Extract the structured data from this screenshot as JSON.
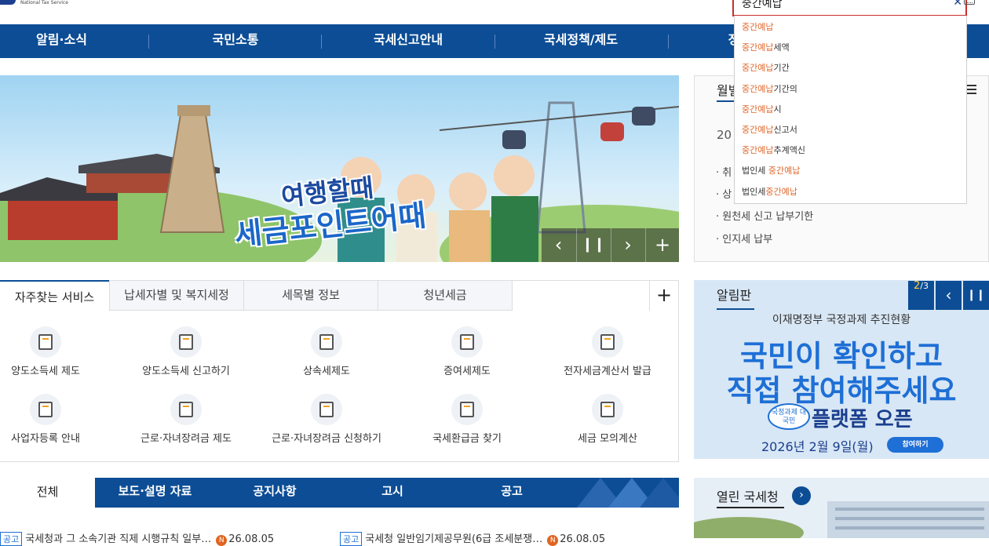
{
  "header": {
    "logo_subtitle": "National Tax Service",
    "search": {
      "value": "중간예납",
      "placeholder": ""
    }
  },
  "gnb": {
    "items": [
      "알림·소식",
      "국민소통",
      "국세신고안내",
      "국세정책/제도",
      "정"
    ]
  },
  "autocomplete": {
    "suggestions": [
      {
        "pre": "",
        "hl": "중간예납",
        "post": ""
      },
      {
        "pre": "",
        "hl": "중간예납",
        "post": "세액"
      },
      {
        "pre": "",
        "hl": "중간예납",
        "post": "기간"
      },
      {
        "pre": "",
        "hl": "중간예납",
        "post": "기간의"
      },
      {
        "pre": "",
        "hl": "중간예납",
        "post": "시"
      },
      {
        "pre": "",
        "hl": "중간예납",
        "post": "신고서"
      },
      {
        "pre": "",
        "hl": "중간예납",
        "post": "추계액신"
      },
      {
        "pre": "법인세 ",
        "hl": "중간예납",
        "post": ""
      },
      {
        "pre": "법인세",
        "hl": "중간예납",
        "post": ""
      }
    ]
  },
  "banner": {
    "title_line1": "여행할때",
    "title_line2": "세금포인트어때"
  },
  "schedule": {
    "tab": "월별",
    "year_prefix": "20",
    "items": [
      "· 취",
      "· 상",
      "· 원천세 신고 납부기한",
      "· 인지세 납부"
    ]
  },
  "services": {
    "tabs": [
      "자주찾는 서비스",
      "납세자별 및 복지세정",
      "세목별 정보",
      "청년세금"
    ],
    "more": "+",
    "items": [
      {
        "label": "양도소득세 제도",
        "icon": "pen-document-icon"
      },
      {
        "label": "양도소득세 신고하기",
        "icon": "document-icon"
      },
      {
        "label": "상속세제도",
        "icon": "laptop-icon"
      },
      {
        "label": "증여세제도",
        "icon": "people-exchange-icon"
      },
      {
        "label": "전자세금계산서 발급",
        "icon": "calculator-icon"
      },
      {
        "label": "사업자등록 안내",
        "icon": "id-card-icon"
      },
      {
        "label": "근로·자녀장려금 제도",
        "icon": "person-icon"
      },
      {
        "label": "근로·자녀장려금 신청하기",
        "icon": "form-icon"
      },
      {
        "label": "국세환급금 찾기",
        "icon": "magnifier-coin-icon"
      },
      {
        "label": "세금 모의계산",
        "icon": "calc-grid-icon"
      }
    ]
  },
  "notice_board": {
    "title": "알림판",
    "page_current": "2",
    "page_total": "3",
    "line1": "이재명정부 국정과제 추진현황",
    "line2": "국민이 확인하고",
    "line3": "직접 참여해주세요",
    "badge": "국정과제 대국민",
    "line4": "플랫폼 오픈",
    "date": "2026년 2월 9일(월)",
    "button": "참여하기"
  },
  "news": {
    "tabs": [
      "전체",
      "보도·설명 자료",
      "공지사항",
      "고시",
      "공고"
    ],
    "rows": [
      {
        "tag": "공고",
        "title": "국세청과 그 소속기관 직제 시행규칙 일부…",
        "date": "26.08.05"
      },
      {
        "tag": "공고",
        "title": "국세청 일반임기제공무원(6급 조세분쟁…",
        "date": "26.08.05"
      }
    ]
  },
  "open_nts": {
    "title": "열린 국세청",
    "arrow": "›"
  },
  "colors": {
    "brand_blue": "#0c4d95",
    "highlight_orange": "#e0672b",
    "search_border": "#c9302c"
  }
}
